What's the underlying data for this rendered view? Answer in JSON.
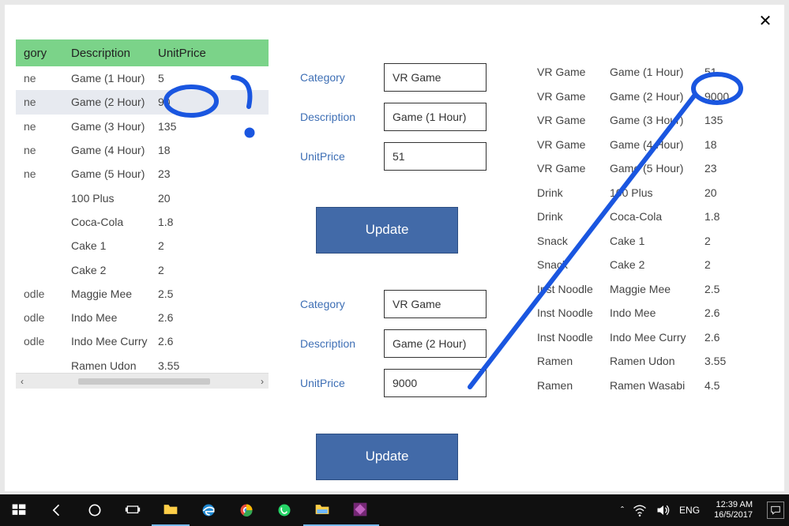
{
  "window": {
    "close_symbol": "✕"
  },
  "grid": {
    "headers": {
      "category": "gory",
      "description": "Description",
      "unitprice": "UnitPrice"
    },
    "rows": [
      {
        "cat": "ne",
        "desc": "Game (1 Hour)",
        "price": "5",
        "selected": false
      },
      {
        "cat": "ne",
        "desc": "Game (2 Hour)",
        "price": "90",
        "selected": true
      },
      {
        "cat": "ne",
        "desc": "Game (3 Hour)",
        "price": "135",
        "selected": false
      },
      {
        "cat": "ne",
        "desc": "Game (4 Hour)",
        "price": "18",
        "selected": false
      },
      {
        "cat": "ne",
        "desc": "Game (5 Hour)",
        "price": "23",
        "selected": false
      },
      {
        "cat": "",
        "desc": "100 Plus",
        "price": "20",
        "selected": false
      },
      {
        "cat": "",
        "desc": "Coca-Cola",
        "price": "1.8",
        "selected": false
      },
      {
        "cat": "",
        "desc": "Cake 1",
        "price": "2",
        "selected": false
      },
      {
        "cat": "",
        "desc": "Cake 2",
        "price": "2",
        "selected": false
      },
      {
        "cat": "odle",
        "desc": "Maggie Mee",
        "price": "2.5",
        "selected": false
      },
      {
        "cat": "odle",
        "desc": "Indo Mee",
        "price": "2.6",
        "selected": false
      },
      {
        "cat": "odle",
        "desc": "Indo Mee Curry",
        "price": "2.6",
        "selected": false
      },
      {
        "cat": "",
        "desc": "Ramen Udon",
        "price": "3.55",
        "selected": false
      }
    ],
    "scroll": {
      "left_arrow": "‹",
      "right_arrow": "›"
    }
  },
  "forms": {
    "labels": {
      "category": "Category",
      "description": "Description",
      "unitprice": "UnitPrice",
      "update": "Update"
    },
    "form1": {
      "category": "VR Game",
      "description": "Game (1 Hour)",
      "unitprice": "51"
    },
    "form2": {
      "category": "VR Game",
      "description": "Game (2 Hour)",
      "unitprice": "9000"
    }
  },
  "result": {
    "rows": [
      {
        "cat": "VR Game",
        "desc": "Game (1 Hour)",
        "price": "51"
      },
      {
        "cat": "VR Game",
        "desc": "Game (2 Hour)",
        "price": "9000"
      },
      {
        "cat": "VR Game",
        "desc": "Game (3 Hour)",
        "price": "135"
      },
      {
        "cat": "VR Game",
        "desc": "Game (4 Hour)",
        "price": "18"
      },
      {
        "cat": "VR Game",
        "desc": "Game (5 Hour)",
        "price": "23"
      },
      {
        "cat": "Drink",
        "desc": "100 Plus",
        "price": "20"
      },
      {
        "cat": "Drink",
        "desc": "Coca-Cola",
        "price": "1.8"
      },
      {
        "cat": "Snack",
        "desc": "Cake 1",
        "price": "2"
      },
      {
        "cat": "Snack",
        "desc": "Cake 2",
        "price": "2"
      },
      {
        "cat": "Inst Noodle",
        "desc": "Maggie Mee",
        "price": "2.5"
      },
      {
        "cat": "Inst Noodle",
        "desc": "Indo Mee",
        "price": "2.6"
      },
      {
        "cat": "Inst Noodle",
        "desc": "Indo Mee Curry",
        "price": "2.6"
      },
      {
        "cat": "Ramen",
        "desc": "Ramen Udon",
        "price": "3.55"
      },
      {
        "cat": "Ramen",
        "desc": "Ramen Wasabi",
        "price": "4.5"
      }
    ]
  },
  "taskbar": {
    "tray": {
      "up": "ˆ",
      "wifi": "wifi",
      "sound": "snd",
      "lang": "ENG",
      "time": "12:39 AM",
      "date": "16/5/2017",
      "notif": "💬"
    }
  },
  "colors": {
    "ink": "#1a56e0",
    "header_bg": "#7bd389",
    "button_bg": "#426aa8"
  }
}
